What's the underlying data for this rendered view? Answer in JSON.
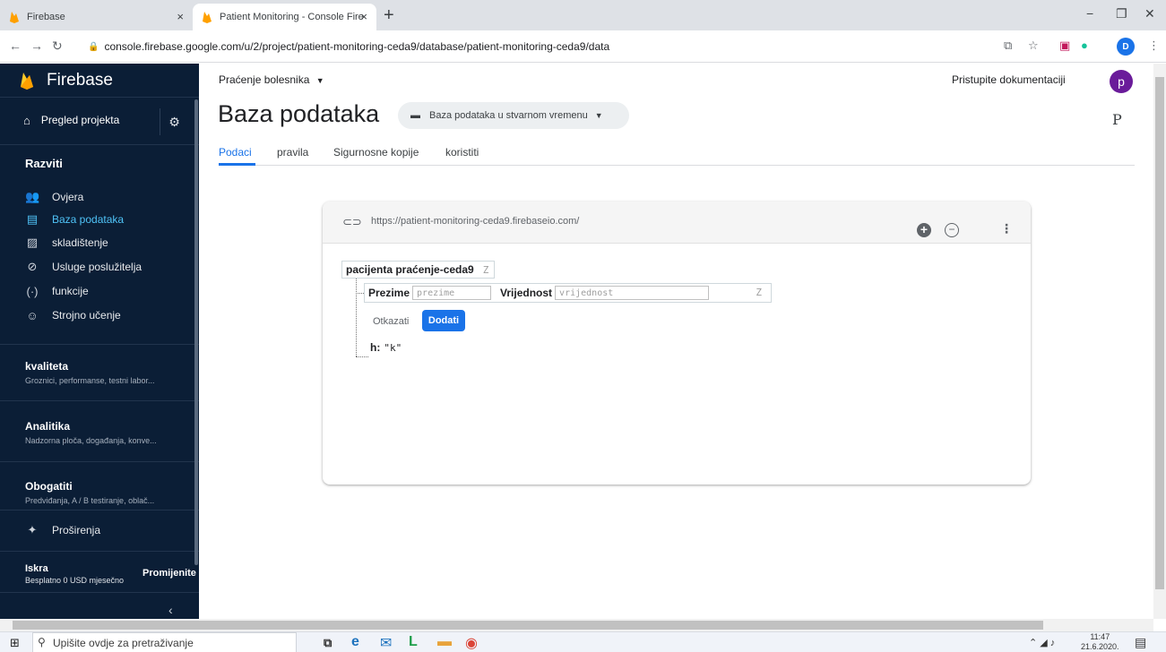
{
  "browser": {
    "tabs": [
      {
        "title": "Firebase",
        "close": "×"
      },
      {
        "title": "Patient Monitoring - Console Fire",
        "close": "×"
      }
    ],
    "new_tab": "+",
    "url": "console.firebase.google.com/u/2/project/patient-monitoring-ceda9/database/patient-monitoring-ceda9/data",
    "profile_initial": "D",
    "window_controls": {
      "minimize": "−",
      "maximize": "❐",
      "close": "✕"
    }
  },
  "sidebar": {
    "brand": "Firebase",
    "overview": "Pregled projekta",
    "develop_heading": "Razviti",
    "develop_items": [
      {
        "label": "Ovjera",
        "icon": "people-icon"
      },
      {
        "label": "Baza podataka",
        "icon": "database-icon",
        "active": true
      },
      {
        "label": "skladištenje",
        "icon": "image-icon"
      },
      {
        "label": "Usluge poslužitelja",
        "icon": "hosting-icon"
      },
      {
        "label": "funkcije",
        "icon": "functions-icon"
      },
      {
        "label": "Strojno učenje",
        "icon": "robot-icon"
      }
    ],
    "quality": {
      "title": "kvaliteta",
      "subtitle": "Groznici, performanse, testni labor..."
    },
    "analytics": {
      "title": "Analitika",
      "subtitle": "Nadzorna ploča, događanja, konve..."
    },
    "grow": {
      "title": "Obogatiti",
      "subtitle": "Predviđanja, A / B testiranje, oblač..."
    },
    "extensions": "Proširenja",
    "plan": {
      "name": "Iskra",
      "description": "Besplatno 0 USD mjesečno",
      "change_label": "Promijenite p"
    }
  },
  "header": {
    "project": "Praćenje bolesnika",
    "docs_link": "Pristupite dokumentaciji",
    "avatar_initial": "p",
    "title": "Baza podataka",
    "db_selector": "Baza podataka u stvarnom vremenu",
    "p_mark": "P"
  },
  "tabs": [
    {
      "label": "Podaci",
      "active": true
    },
    {
      "label": "pravila"
    },
    {
      "label": "Sigurnosne kopije"
    },
    {
      "label": "koristiti"
    }
  ],
  "database": {
    "url": "https://patient-monitoring-ceda9.firebaseio.com/",
    "root_key": "pacijenta praćenje-ceda9",
    "z_glyph": "Z",
    "edit": {
      "name_label": "Prezime",
      "name_placeholder": "prezime",
      "value_label": "Vrijednost",
      "value_placeholder": "vrijednost",
      "cancel": "Otkazati",
      "add": "Dodati"
    },
    "child": {
      "key": "h:",
      "value": "\"k\""
    }
  },
  "taskbar": {
    "search_placeholder": "Upišite ovdje za pretraživanje",
    "time": "11:47",
    "date": "21.6.2020."
  },
  "colors": {
    "sidebar_bg": "#0b1e36",
    "accent": "#1a73e8",
    "active_nav": "#4fc3f7",
    "avatar": "#6a1b9a"
  }
}
